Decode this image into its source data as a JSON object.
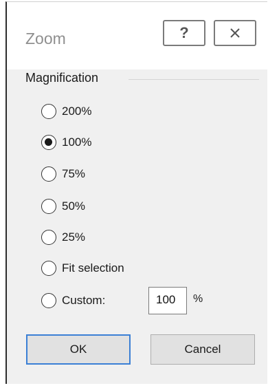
{
  "window": {
    "title": "Zoom",
    "help_glyph": "?",
    "help_icon": "help-icon",
    "close_icon": "close-icon"
  },
  "magnification": {
    "label": "Magnification",
    "options": [
      {
        "label": "200%",
        "checked": false
      },
      {
        "label": "100%",
        "checked": true
      },
      {
        "label": "75%",
        "checked": false
      },
      {
        "label": "50%",
        "checked": false
      },
      {
        "label": "25%",
        "checked": false
      },
      {
        "label": "Fit selection",
        "checked": false
      },
      {
        "label": "Custom:",
        "checked": false
      }
    ],
    "custom_value": "100",
    "custom_unit": "%"
  },
  "buttons": {
    "ok": "OK",
    "cancel": "Cancel"
  },
  "colors": {
    "ok_border": "#3a7fd5",
    "dialog_bg": "#f0f0f0"
  }
}
